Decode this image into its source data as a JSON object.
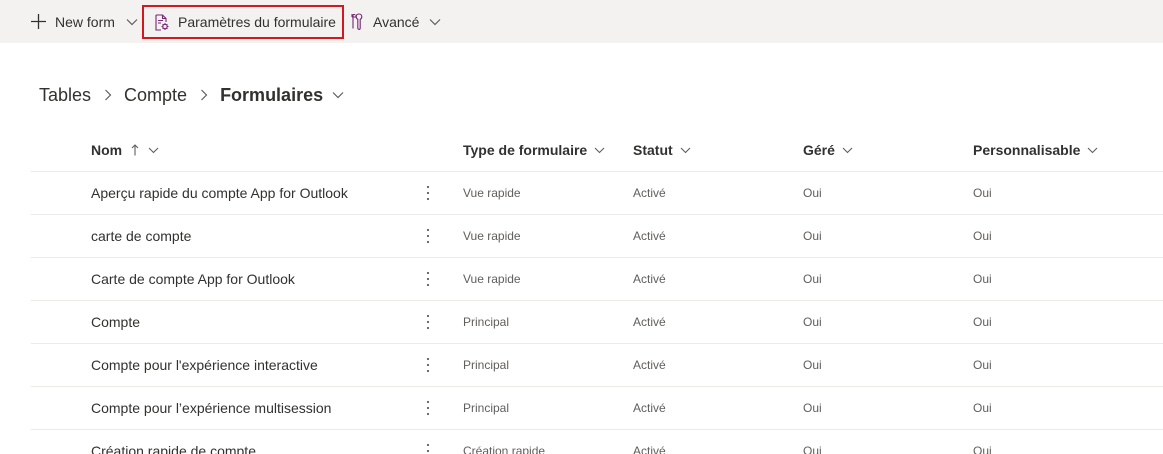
{
  "commandbar": {
    "new_form": "New form",
    "settings": "Paramètres du formulaire",
    "advanced": "Avancé"
  },
  "breadcrumb": {
    "tables": "Tables",
    "entity": "Compte",
    "current": "Formulaires"
  },
  "table": {
    "headers": {
      "name": "Nom",
      "type": "Type de formulaire",
      "status": "Statut",
      "managed": "Géré",
      "customizable": "Personnalisable"
    },
    "sort": {
      "column": "name",
      "direction": "ascending"
    },
    "rows": [
      {
        "name": "Aperçu rapide du compte App for Outlook",
        "type": "Vue rapide",
        "status": "Activé",
        "managed": "Oui",
        "customizable": "Oui"
      },
      {
        "name": "carte de compte",
        "type": "Vue rapide",
        "status": "Activé",
        "managed": "Oui",
        "customizable": "Oui"
      },
      {
        "name": "Carte de compte App for Outlook",
        "type": "Vue rapide",
        "status": "Activé",
        "managed": "Oui",
        "customizable": "Oui"
      },
      {
        "name": "Compte",
        "type": "Principal",
        "status": "Activé",
        "managed": "Oui",
        "customizable": "Oui"
      },
      {
        "name": "Compte pour l'expérience interactive",
        "type": "Principal",
        "status": "Activé",
        "managed": "Oui",
        "customizable": "Oui"
      },
      {
        "name": "Compte pour l’expérience multisession",
        "type": "Principal",
        "status": "Activé",
        "managed": "Oui",
        "customizable": "Oui"
      },
      {
        "name": "Création rapide de compte",
        "type": "Création rapide",
        "status": "Activé",
        "managed": "Oui",
        "customizable": "Oui"
      }
    ]
  },
  "icons": {
    "new": "plus-icon",
    "settings": "form-settings-icon",
    "advanced": "wrench-icon",
    "more": "more-vertical-icon"
  },
  "colors": {
    "commandbar_bg": "#f3f2f1",
    "highlight_border": "#d1191f",
    "accent": "#742774"
  }
}
